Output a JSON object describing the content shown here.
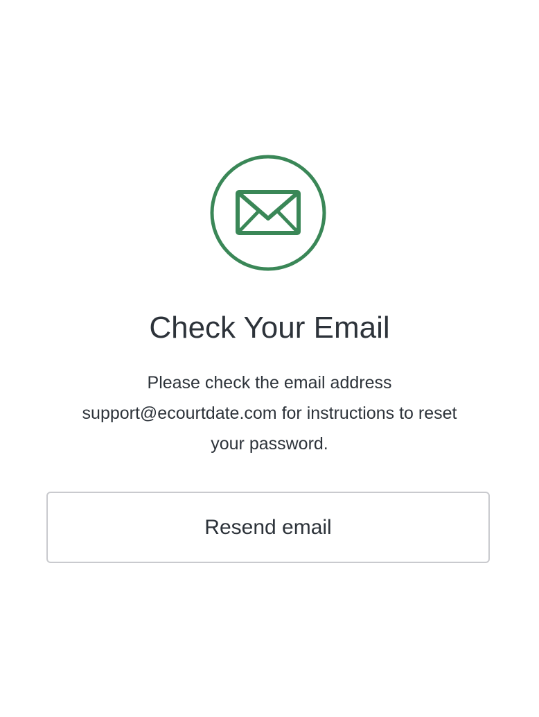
{
  "icon": {
    "name": "envelope-icon",
    "color": "#3a8757"
  },
  "heading": {
    "title": "Check Your Email"
  },
  "message": {
    "line1": "Please check the email address",
    "line2": "support@ecourtdate.com for instructions to reset",
    "line3": "your password."
  },
  "actions": {
    "resend_label": "Resend email"
  }
}
